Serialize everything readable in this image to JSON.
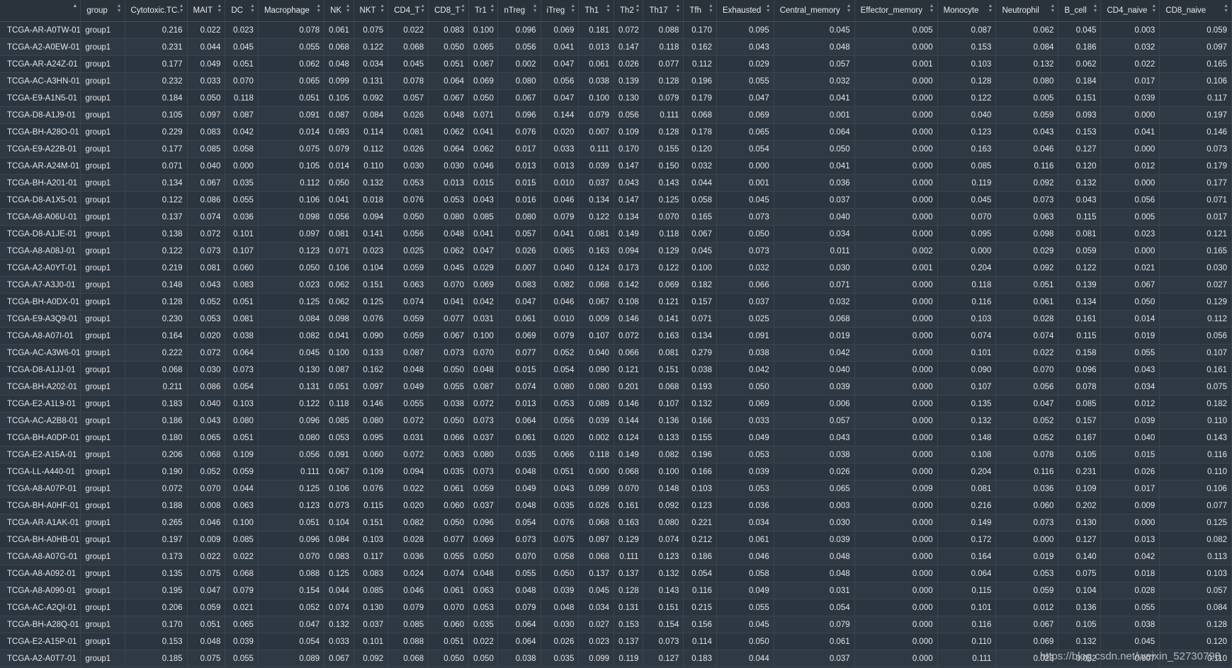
{
  "columns": [
    "",
    "group",
    "Cytotoxic.TC.",
    "MAIT",
    "DC",
    "Macrophage",
    "NK",
    "NKT",
    "CD4_T",
    "CD8_T",
    "Tr1",
    "nTreg",
    "iTreg",
    "Th1",
    "Th2",
    "Th17",
    "Tfh",
    "Exhausted",
    "Central_memory",
    "Effector_memory",
    "Monocyte",
    "Neutrophil",
    "B_cell",
    "CD4_naive",
    "CD8_naive"
  ],
  "rows": [
    [
      "TCGA-AR-A0TW-01",
      "group1",
      "0.216",
      "0.022",
      "0.023",
      "0.078",
      "0.061",
      "0.075",
      "0.022",
      "0.083",
      "0.100",
      "0.096",
      "0.069",
      "0.181",
      "0.072",
      "0.088",
      "0.170",
      "0.095",
      "0.045",
      "0.005",
      "0.087",
      "0.062",
      "0.045",
      "0.003",
      "0.059"
    ],
    [
      "TCGA-A2-A0EW-01",
      "group1",
      "0.231",
      "0.044",
      "0.045",
      "0.055",
      "0.068",
      "0.122",
      "0.068",
      "0.050",
      "0.065",
      "0.056",
      "0.041",
      "0.013",
      "0.147",
      "0.118",
      "0.162",
      "0.043",
      "0.048",
      "0.000",
      "0.153",
      "0.084",
      "0.186",
      "0.032",
      "0.097"
    ],
    [
      "TCGA-AR-A24Z-01",
      "group1",
      "0.177",
      "0.049",
      "0.051",
      "0.062",
      "0.048",
      "0.034",
      "0.045",
      "0.051",
      "0.067",
      "0.002",
      "0.047",
      "0.061",
      "0.026",
      "0.077",
      "0.112",
      "0.029",
      "0.057",
      "0.001",
      "0.103",
      "0.132",
      "0.062",
      "0.022",
      "0.165"
    ],
    [
      "TCGA-AC-A3HN-01",
      "group1",
      "0.232",
      "0.033",
      "0.070",
      "0.065",
      "0.099",
      "0.131",
      "0.078",
      "0.064",
      "0.069",
      "0.080",
      "0.056",
      "0.038",
      "0.139",
      "0.128",
      "0.196",
      "0.055",
      "0.032",
      "0.000",
      "0.128",
      "0.080",
      "0.184",
      "0.017",
      "0.106"
    ],
    [
      "TCGA-E9-A1N5-01",
      "group1",
      "0.184",
      "0.050",
      "0.118",
      "0.051",
      "0.105",
      "0.092",
      "0.057",
      "0.067",
      "0.050",
      "0.067",
      "0.047",
      "0.100",
      "0.130",
      "0.079",
      "0.179",
      "0.047",
      "0.041",
      "0.000",
      "0.122",
      "0.005",
      "0.151",
      "0.039",
      "0.117"
    ],
    [
      "TCGA-D8-A1J9-01",
      "group1",
      "0.105",
      "0.097",
      "0.087",
      "0.091",
      "0.087",
      "0.084",
      "0.026",
      "0.048",
      "0.071",
      "0.096",
      "0.144",
      "0.079",
      "0.056",
      "0.111",
      "0.068",
      "0.069",
      "0.001",
      "0.000",
      "0.040",
      "0.059",
      "0.093",
      "0.000",
      "0.197"
    ],
    [
      "TCGA-BH-A28O-01",
      "group1",
      "0.229",
      "0.083",
      "0.042",
      "0.014",
      "0.093",
      "0.114",
      "0.081",
      "0.062",
      "0.041",
      "0.076",
      "0.020",
      "0.007",
      "0.109",
      "0.128",
      "0.178",
      "0.065",
      "0.064",
      "0.000",
      "0.123",
      "0.043",
      "0.153",
      "0.041",
      "0.146"
    ],
    [
      "TCGA-E9-A22B-01",
      "group1",
      "0.177",
      "0.085",
      "0.058",
      "0.075",
      "0.079",
      "0.112",
      "0.026",
      "0.064",
      "0.062",
      "0.017",
      "0.033",
      "0.111",
      "0.170",
      "0.155",
      "0.120",
      "0.054",
      "0.050",
      "0.000",
      "0.163",
      "0.046",
      "0.127",
      "0.000",
      "0.073"
    ],
    [
      "TCGA-AR-A24M-01",
      "group1",
      "0.071",
      "0.040",
      "0.000",
      "0.105",
      "0.014",
      "0.110",
      "0.030",
      "0.030",
      "0.046",
      "0.013",
      "0.013",
      "0.039",
      "0.147",
      "0.150",
      "0.032",
      "0.000",
      "0.041",
      "0.000",
      "0.085",
      "0.116",
      "0.120",
      "0.012",
      "0.179"
    ],
    [
      "TCGA-BH-A201-01",
      "group1",
      "0.134",
      "0.067",
      "0.035",
      "0.112",
      "0.050",
      "0.132",
      "0.053",
      "0.013",
      "0.015",
      "0.015",
      "0.010",
      "0.037",
      "0.043",
      "0.143",
      "0.044",
      "0.001",
      "0.036",
      "0.000",
      "0.119",
      "0.092",
      "0.132",
      "0.000",
      "0.177"
    ],
    [
      "TCGA-D8-A1X5-01",
      "group1",
      "0.122",
      "0.086",
      "0.055",
      "0.106",
      "0.041",
      "0.018",
      "0.076",
      "0.053",
      "0.043",
      "0.016",
      "0.046",
      "0.134",
      "0.147",
      "0.125",
      "0.058",
      "0.045",
      "0.037",
      "0.000",
      "0.045",
      "0.073",
      "0.043",
      "0.056",
      "0.071"
    ],
    [
      "TCGA-A8-A06U-01",
      "group1",
      "0.137",
      "0.074",
      "0.036",
      "0.098",
      "0.056",
      "0.094",
      "0.050",
      "0.080",
      "0.085",
      "0.080",
      "0.079",
      "0.122",
      "0.134",
      "0.070",
      "0.165",
      "0.073",
      "0.040",
      "0.000",
      "0.070",
      "0.063",
      "0.115",
      "0.005",
      "0.017"
    ],
    [
      "TCGA-D8-A1JE-01",
      "group1",
      "0.138",
      "0.072",
      "0.101",
      "0.097",
      "0.081",
      "0.141",
      "0.056",
      "0.048",
      "0.041",
      "0.057",
      "0.041",
      "0.081",
      "0.149",
      "0.118",
      "0.067",
      "0.050",
      "0.034",
      "0.000",
      "0.095",
      "0.098",
      "0.081",
      "0.023",
      "0.121"
    ],
    [
      "TCGA-A8-A08J-01",
      "group1",
      "0.122",
      "0.073",
      "0.107",
      "0.123",
      "0.071",
      "0.023",
      "0.025",
      "0.062",
      "0.047",
      "0.026",
      "0.065",
      "0.163",
      "0.094",
      "0.129",
      "0.045",
      "0.073",
      "0.011",
      "0.002",
      "0.000",
      "0.029",
      "0.059",
      "0.000",
      "0.165"
    ],
    [
      "TCGA-A2-A0YT-01",
      "group1",
      "0.219",
      "0.081",
      "0.060",
      "0.050",
      "0.106",
      "0.104",
      "0.059",
      "0.045",
      "0.029",
      "0.007",
      "0.040",
      "0.124",
      "0.173",
      "0.122",
      "0.100",
      "0.032",
      "0.030",
      "0.001",
      "0.204",
      "0.092",
      "0.122",
      "0.021",
      "0.030"
    ],
    [
      "TCGA-A7-A3J0-01",
      "group1",
      "0.148",
      "0.043",
      "0.083",
      "0.023",
      "0.062",
      "0.151",
      "0.063",
      "0.070",
      "0.069",
      "0.083",
      "0.082",
      "0.068",
      "0.142",
      "0.069",
      "0.182",
      "0.066",
      "0.071",
      "0.000",
      "0.118",
      "0.051",
      "0.139",
      "0.067",
      "0.027"
    ],
    [
      "TCGA-BH-A0DX-01",
      "group1",
      "0.128",
      "0.052",
      "0.051",
      "0.125",
      "0.062",
      "0.125",
      "0.074",
      "0.041",
      "0.042",
      "0.047",
      "0.046",
      "0.067",
      "0.108",
      "0.121",
      "0.157",
      "0.037",
      "0.032",
      "0.000",
      "0.116",
      "0.061",
      "0.134",
      "0.050",
      "0.129"
    ],
    [
      "TCGA-E9-A3Q9-01",
      "group1",
      "0.230",
      "0.053",
      "0.081",
      "0.084",
      "0.098",
      "0.076",
      "0.059",
      "0.077",
      "0.031",
      "0.061",
      "0.010",
      "0.009",
      "0.146",
      "0.141",
      "0.071",
      "0.025",
      "0.068",
      "0.000",
      "0.103",
      "0.028",
      "0.161",
      "0.014",
      "0.112"
    ],
    [
      "TCGA-A8-A07I-01",
      "group1",
      "0.164",
      "0.020",
      "0.038",
      "0.082",
      "0.041",
      "0.090",
      "0.059",
      "0.067",
      "0.100",
      "0.069",
      "0.079",
      "0.107",
      "0.072",
      "0.163",
      "0.134",
      "0.091",
      "0.019",
      "0.000",
      "0.074",
      "0.074",
      "0.115",
      "0.019",
      "0.056"
    ],
    [
      "TCGA-AC-A3W6-01",
      "group1",
      "0.222",
      "0.072",
      "0.064",
      "0.045",
      "0.100",
      "0.133",
      "0.087",
      "0.073",
      "0.070",
      "0.077",
      "0.052",
      "0.040",
      "0.066",
      "0.081",
      "0.279",
      "0.038",
      "0.042",
      "0.000",
      "0.101",
      "0.022",
      "0.158",
      "0.055",
      "0.107"
    ],
    [
      "TCGA-D8-A1JJ-01",
      "group1",
      "0.068",
      "0.030",
      "0.073",
      "0.130",
      "0.087",
      "0.162",
      "0.048",
      "0.050",
      "0.048",
      "0.015",
      "0.054",
      "0.090",
      "0.121",
      "0.151",
      "0.038",
      "0.042",
      "0.040",
      "0.000",
      "0.090",
      "0.070",
      "0.096",
      "0.043",
      "0.161"
    ],
    [
      "TCGA-BH-A202-01",
      "group1",
      "0.211",
      "0.086",
      "0.054",
      "0.131",
      "0.051",
      "0.097",
      "0.049",
      "0.055",
      "0.087",
      "0.074",
      "0.080",
      "0.080",
      "0.201",
      "0.068",
      "0.193",
      "0.050",
      "0.039",
      "0.000",
      "0.107",
      "0.056",
      "0.078",
      "0.034",
      "0.075"
    ],
    [
      "TCGA-E2-A1L9-01",
      "group1",
      "0.183",
      "0.040",
      "0.103",
      "0.122",
      "0.118",
      "0.146",
      "0.055",
      "0.038",
      "0.072",
      "0.013",
      "0.053",
      "0.089",
      "0.146",
      "0.107",
      "0.132",
      "0.069",
      "0.006",
      "0.000",
      "0.135",
      "0.047",
      "0.085",
      "0.012",
      "0.182"
    ],
    [
      "TCGA-AC-A2B8-01",
      "group1",
      "0.186",
      "0.043",
      "0.080",
      "0.096",
      "0.085",
      "0.080",
      "0.072",
      "0.050",
      "0.073",
      "0.064",
      "0.056",
      "0.039",
      "0.144",
      "0.136",
      "0.166",
      "0.033",
      "0.057",
      "0.000",
      "0.132",
      "0.052",
      "0.157",
      "0.039",
      "0.110"
    ],
    [
      "TCGA-BH-A0DP-01",
      "group1",
      "0.180",
      "0.065",
      "0.051",
      "0.080",
      "0.053",
      "0.095",
      "0.031",
      "0.066",
      "0.037",
      "0.061",
      "0.020",
      "0.002",
      "0.124",
      "0.133",
      "0.155",
      "0.049",
      "0.043",
      "0.000",
      "0.148",
      "0.052",
      "0.167",
      "0.040",
      "0.143"
    ],
    [
      "TCGA-E2-A15A-01",
      "group1",
      "0.206",
      "0.068",
      "0.109",
      "0.056",
      "0.091",
      "0.060",
      "0.072",
      "0.063",
      "0.080",
      "0.035",
      "0.066",
      "0.118",
      "0.149",
      "0.082",
      "0.196",
      "0.053",
      "0.038",
      "0.000",
      "0.108",
      "0.078",
      "0.105",
      "0.015",
      "0.116"
    ],
    [
      "TCGA-LL-A440-01",
      "group1",
      "0.190",
      "0.052",
      "0.059",
      "0.111",
      "0.067",
      "0.109",
      "0.094",
      "0.035",
      "0.073",
      "0.048",
      "0.051",
      "0.000",
      "0.068",
      "0.100",
      "0.166",
      "0.039",
      "0.026",
      "0.000",
      "0.204",
      "0.116",
      "0.231",
      "0.026",
      "0.110"
    ],
    [
      "TCGA-A8-A07P-01",
      "group1",
      "0.072",
      "0.070",
      "0.044",
      "0.125",
      "0.106",
      "0.076",
      "0.022",
      "0.061",
      "0.059",
      "0.049",
      "0.043",
      "0.099",
      "0.070",
      "0.148",
      "0.103",
      "0.053",
      "0.065",
      "0.009",
      "0.081",
      "0.036",
      "0.109",
      "0.017",
      "0.106"
    ],
    [
      "TCGA-BH-A0HF-01",
      "group1",
      "0.188",
      "0.008",
      "0.063",
      "0.123",
      "0.073",
      "0.115",
      "0.020",
      "0.060",
      "0.037",
      "0.048",
      "0.035",
      "0.026",
      "0.161",
      "0.092",
      "0.123",
      "0.036",
      "0.003",
      "0.000",
      "0.216",
      "0.060",
      "0.202",
      "0.009",
      "0.077"
    ],
    [
      "TCGA-AR-A1AK-01",
      "group1",
      "0.265",
      "0.046",
      "0.100",
      "0.051",
      "0.104",
      "0.151",
      "0.082",
      "0.050",
      "0.096",
      "0.054",
      "0.076",
      "0.068",
      "0.163",
      "0.080",
      "0.221",
      "0.034",
      "0.030",
      "0.000",
      "0.149",
      "0.073",
      "0.130",
      "0.000",
      "0.125"
    ],
    [
      "TCGA-BH-A0HB-01",
      "group1",
      "0.197",
      "0.009",
      "0.085",
      "0.096",
      "0.084",
      "0.103",
      "0.028",
      "0.077",
      "0.069",
      "0.073",
      "0.075",
      "0.097",
      "0.129",
      "0.074",
      "0.212",
      "0.061",
      "0.039",
      "0.000",
      "0.172",
      "0.000",
      "0.127",
      "0.013",
      "0.082"
    ],
    [
      "TCGA-A8-A07G-01",
      "group1",
      "0.173",
      "0.022",
      "0.022",
      "0.070",
      "0.083",
      "0.117",
      "0.036",
      "0.055",
      "0.050",
      "0.070",
      "0.058",
      "0.068",
      "0.111",
      "0.123",
      "0.186",
      "0.046",
      "0.048",
      "0.000",
      "0.164",
      "0.019",
      "0.140",
      "0.042",
      "0.113"
    ],
    [
      "TCGA-A8-A092-01",
      "group1",
      "0.135",
      "0.075",
      "0.068",
      "0.088",
      "0.125",
      "0.083",
      "0.024",
      "0.074",
      "0.048",
      "0.055",
      "0.050",
      "0.137",
      "0.137",
      "0.132",
      "0.054",
      "0.058",
      "0.048",
      "0.000",
      "0.064",
      "0.053",
      "0.075",
      "0.018",
      "0.103"
    ],
    [
      "TCGA-A8-A090-01",
      "group1",
      "0.195",
      "0.047",
      "0.079",
      "0.154",
      "0.044",
      "0.085",
      "0.046",
      "0.061",
      "0.063",
      "0.048",
      "0.039",
      "0.045",
      "0.128",
      "0.143",
      "0.116",
      "0.049",
      "0.031",
      "0.000",
      "0.115",
      "0.059",
      "0.104",
      "0.028",
      "0.057"
    ],
    [
      "TCGA-AC-A2QI-01",
      "group1",
      "0.206",
      "0.059",
      "0.021",
      "0.052",
      "0.074",
      "0.130",
      "0.079",
      "0.070",
      "0.053",
      "0.079",
      "0.048",
      "0.034",
      "0.131",
      "0.151",
      "0.215",
      "0.055",
      "0.054",
      "0.000",
      "0.101",
      "0.012",
      "0.136",
      "0.055",
      "0.084"
    ],
    [
      "TCGA-BH-A28Q-01",
      "group1",
      "0.170",
      "0.051",
      "0.065",
      "0.047",
      "0.132",
      "0.037",
      "0.085",
      "0.060",
      "0.035",
      "0.064",
      "0.030",
      "0.027",
      "0.153",
      "0.154",
      "0.156",
      "0.045",
      "0.079",
      "0.000",
      "0.116",
      "0.067",
      "0.105",
      "0.038",
      "0.128"
    ],
    [
      "TCGA-E2-A15P-01",
      "group1",
      "0.153",
      "0.048",
      "0.039",
      "0.054",
      "0.033",
      "0.101",
      "0.088",
      "0.051",
      "0.022",
      "0.064",
      "0.026",
      "0.023",
      "0.137",
      "0.073",
      "0.114",
      "0.050",
      "0.061",
      "0.000",
      "0.110",
      "0.069",
      "0.132",
      "0.045",
      "0.120"
    ],
    [
      "TCGA-A2-A0T7-01",
      "group1",
      "0.185",
      "0.075",
      "0.055",
      "0.089",
      "0.067",
      "0.092",
      "0.068",
      "0.050",
      "0.050",
      "0.038",
      "0.035",
      "0.099",
      "0.119",
      "0.127",
      "0.183",
      "0.044",
      "0.037",
      "0.000",
      "0.111",
      "0.023",
      "0.052",
      "0.007",
      "0.110"
    ]
  ],
  "watermark": "https://blog.csdn.net/weixin_52730798",
  "colors": {
    "background": "#2b3540",
    "row_alt": "#2f3944",
    "header": "#2a323b",
    "grid": "#3a4550",
    "text": "#e4e6e8"
  }
}
